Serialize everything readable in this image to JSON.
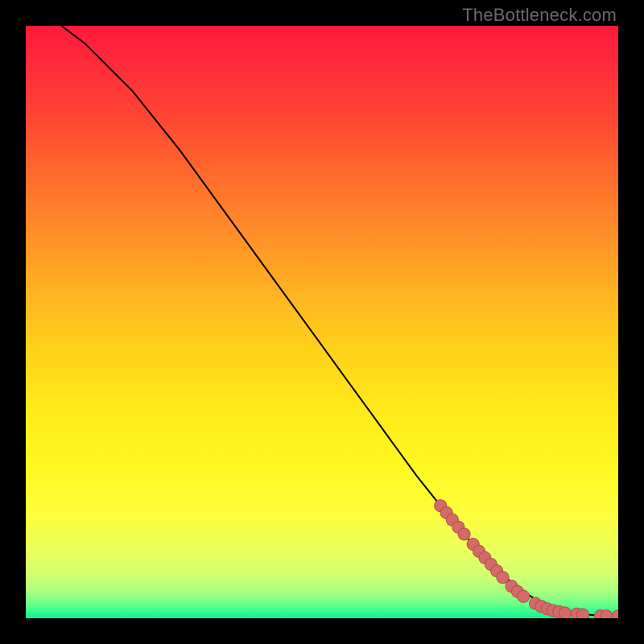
{
  "watermark": "TheBottleneck.com",
  "colors": {
    "curve": "#000000",
    "marker_fill": "#d46a6a",
    "marker_stroke": "#b24e4e"
  },
  "chart_data": {
    "type": "line",
    "title": "",
    "xlabel": "",
    "ylabel": "",
    "xlim": [
      0,
      100
    ],
    "ylim": [
      0,
      100
    ],
    "grid": false,
    "background": "rainbow-vertical-gradient (red→orange→yellow→green near bottom)",
    "series": [
      {
        "name": "curve",
        "x": [
          6,
          10,
          14,
          18,
          22,
          26,
          30,
          34,
          38,
          42,
          46,
          50,
          54,
          58,
          62,
          66,
          70,
          74,
          78,
          82,
          84,
          86,
          88,
          90,
          92,
          94,
          96,
          98,
          100
        ],
        "y": [
          100,
          97,
          93,
          89,
          84,
          79,
          73.5,
          68,
          62.5,
          57,
          51.5,
          46,
          40.5,
          35,
          29.5,
          24,
          19,
          14,
          10,
          6,
          4.5,
          3.2,
          2.2,
          1.5,
          1.0,
          0.7,
          0.5,
          0.4,
          0.35
        ]
      }
    ],
    "markers": [
      {
        "x": 70,
        "y": 19.0
      },
      {
        "x": 71,
        "y": 17.8
      },
      {
        "x": 72,
        "y": 16.6
      },
      {
        "x": 73,
        "y": 15.4
      },
      {
        "x": 74,
        "y": 14.2
      },
      {
        "x": 75.5,
        "y": 12.5
      },
      {
        "x": 76.5,
        "y": 11.3
      },
      {
        "x": 77.5,
        "y": 10.2
      },
      {
        "x": 78.5,
        "y": 9.1
      },
      {
        "x": 79.5,
        "y": 8.0
      },
      {
        "x": 80.5,
        "y": 6.9
      },
      {
        "x": 82,
        "y": 5.4
      },
      {
        "x": 83,
        "y": 4.5
      },
      {
        "x": 84,
        "y": 3.7
      },
      {
        "x": 86,
        "y": 2.5
      },
      {
        "x": 87,
        "y": 2.0
      },
      {
        "x": 88,
        "y": 1.6
      },
      {
        "x": 89,
        "y": 1.3
      },
      {
        "x": 90,
        "y": 1.1
      },
      {
        "x": 91,
        "y": 0.9
      },
      {
        "x": 93,
        "y": 0.7
      },
      {
        "x": 94,
        "y": 0.6
      },
      {
        "x": 97,
        "y": 0.4
      },
      {
        "x": 98,
        "y": 0.38
      },
      {
        "x": 100,
        "y": 0.35
      }
    ]
  }
}
